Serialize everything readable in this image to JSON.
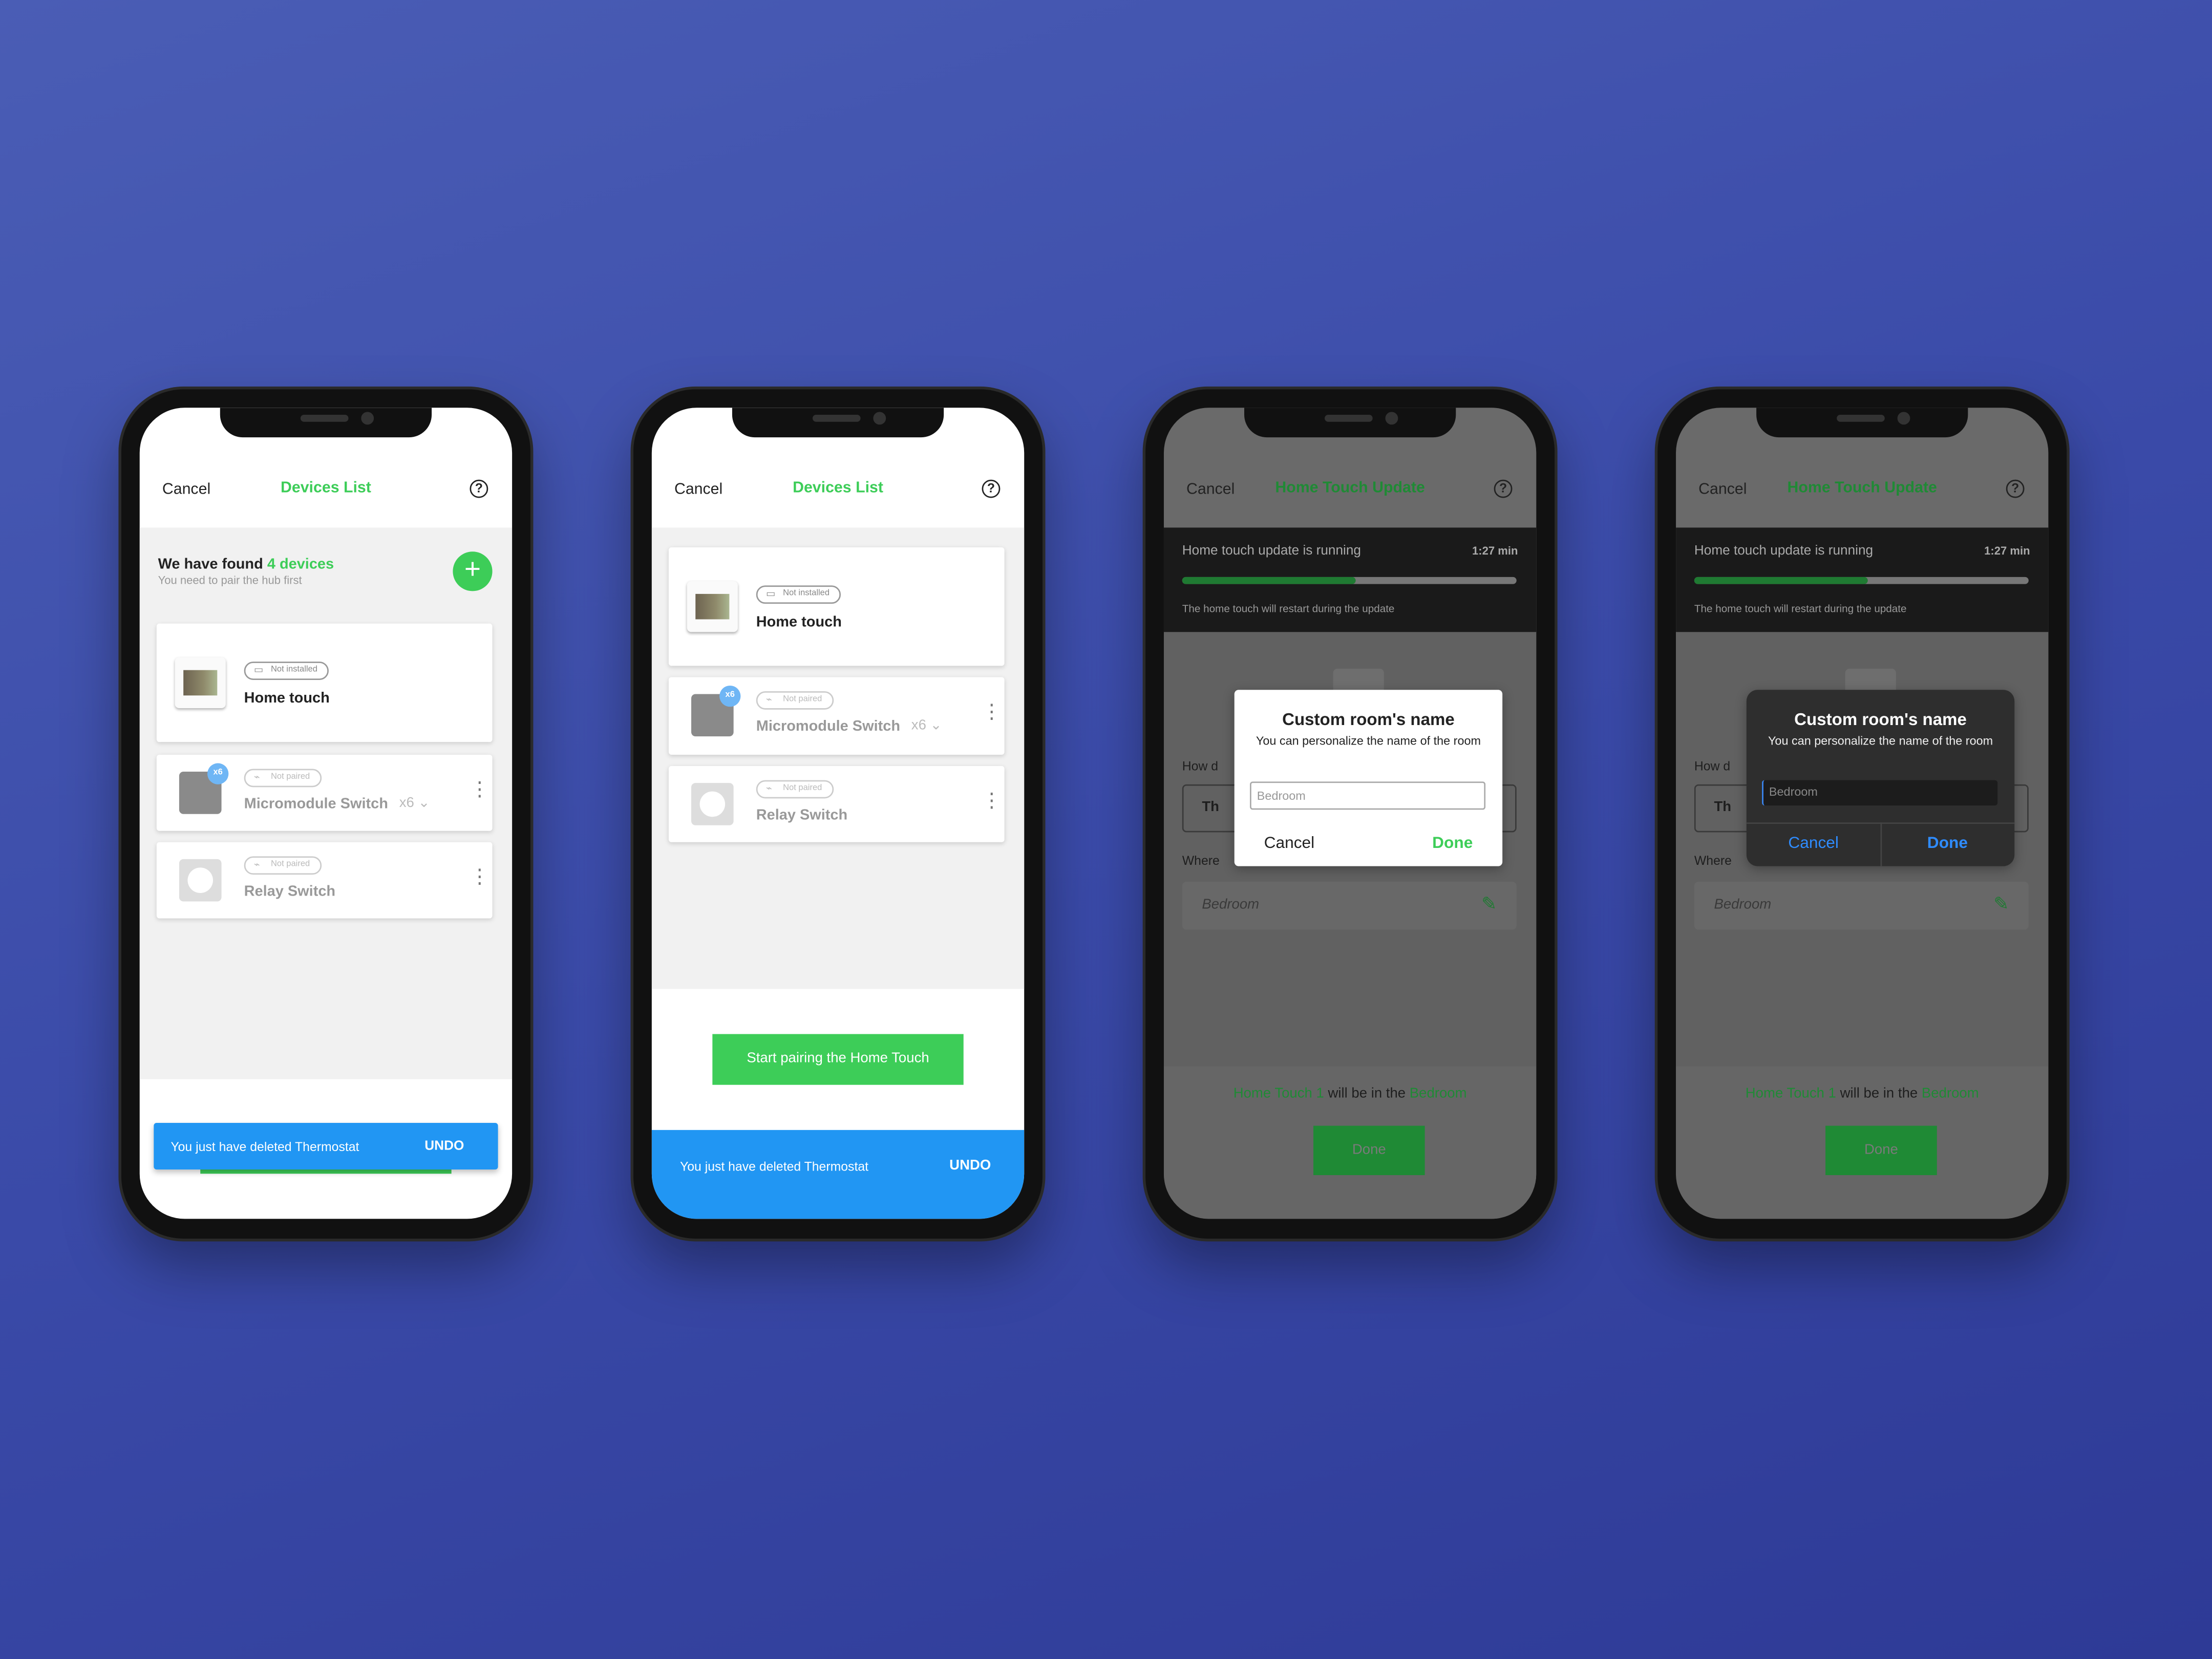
{
  "colors": {
    "brand_green": "#3dcd58",
    "snackbar_blue": "#2196f3",
    "background": "#3f4fae"
  },
  "phone1": {
    "header": {
      "cancel": "Cancel",
      "title": "Devices List",
      "help_icon": "question-circle-icon"
    },
    "found": {
      "prefix": "We have found",
      "count": "4 devices",
      "subtitle": "You need to pair the hub first"
    },
    "add_icon": "plus-icon",
    "devices": [
      {
        "status": "Not installed",
        "name": "Home touch"
      },
      {
        "status": "Not paired",
        "name": "Micromodule Switch",
        "count": "x6",
        "badge": "x6"
      },
      {
        "status": "Not paired",
        "name": "Relay Switch"
      }
    ],
    "snackbar": {
      "message": "You just have deleted Thermostat",
      "action": "UNDO"
    }
  },
  "phone2": {
    "header": {
      "cancel": "Cancel",
      "title": "Devices List"
    },
    "devices": [
      {
        "status": "Not installed",
        "name": "Home touch"
      },
      {
        "status": "Not paired",
        "name": "Micromodule Switch",
        "count": "x6",
        "badge": "x6"
      },
      {
        "status": "Not paired",
        "name": "Relay Switch"
      }
    ],
    "primary_button": "Start pairing the Home Touch",
    "snackbar": {
      "message": "You just have deleted Thermostat",
      "action": "UNDO"
    }
  },
  "update_screen": {
    "header": {
      "cancel": "Cancel",
      "title": "Home Touch Update"
    },
    "banner": {
      "message": "Home touch update is running",
      "time": "1:27 min",
      "progress_percent": 52,
      "note": "The home touch will restart during the update"
    },
    "how_label": "How d",
    "name_value": "Th",
    "where_label": "Where",
    "room_value": "Bedroom",
    "summary": {
      "device": "Home Touch 1",
      "middle": "will be in the",
      "room": "Bedroom"
    },
    "done": "Done"
  },
  "dialog_light": {
    "title": "Custom room's name",
    "subtitle": "You can personalize the name of the room",
    "placeholder": "Bedroom",
    "cancel": "Cancel",
    "done": "Done"
  },
  "dialog_dark": {
    "title": "Custom room's name",
    "subtitle": "You can personalize the name of the room",
    "placeholder": "Bedroom",
    "cancel": "Cancel",
    "done": "Done"
  }
}
